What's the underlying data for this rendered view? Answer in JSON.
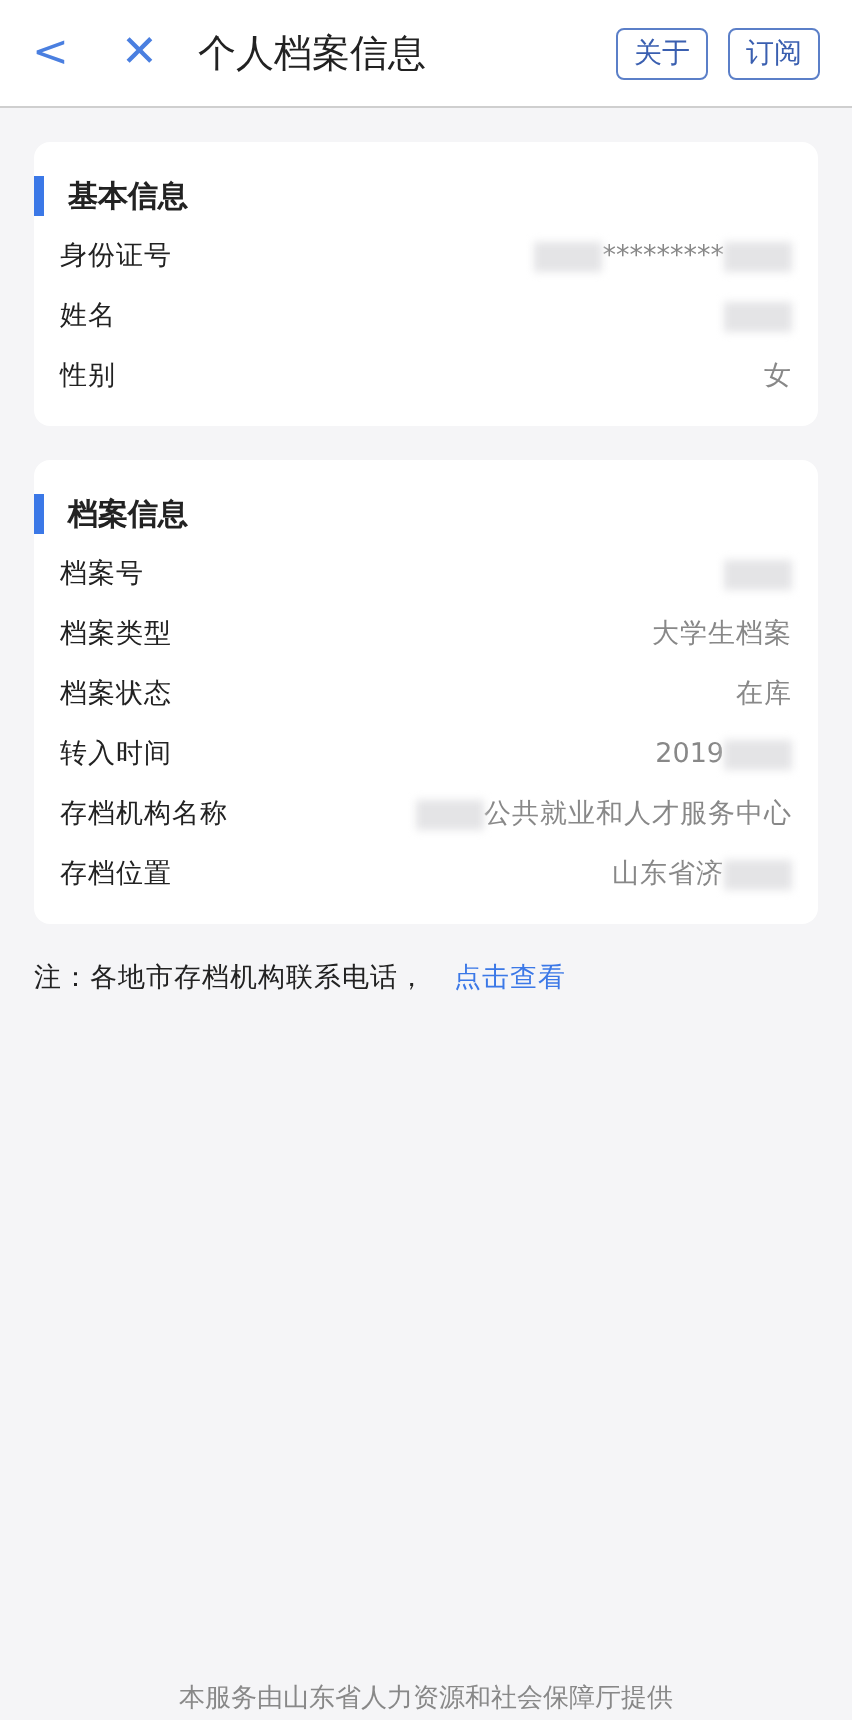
{
  "nav": {
    "back": "<",
    "close": "✕",
    "title": "个人档案信息",
    "buttons": [
      "关于",
      "订阅"
    ]
  },
  "sections": [
    {
      "title": "基本信息",
      "rows": [
        {
          "label": "身份证号",
          "value": [
            {
              "kind": "blur"
            },
            {
              "kind": "text",
              "text": "*********"
            },
            {
              "kind": "blur"
            }
          ]
        },
        {
          "label": "姓名",
          "value": [
            {
              "kind": "blur"
            }
          ]
        },
        {
          "label": "性别",
          "value": [
            {
              "kind": "text",
              "text": "女"
            }
          ]
        }
      ]
    },
    {
      "title": "档案信息",
      "rows": [
        {
          "label": "档案号",
          "value": [
            {
              "kind": "blur"
            }
          ]
        },
        {
          "label": "档案类型",
          "value": [
            {
              "kind": "text",
              "text": "大学生档案"
            }
          ]
        },
        {
          "label": "档案状态",
          "value": [
            {
              "kind": "text",
              "text": "在库"
            }
          ]
        },
        {
          "label": "转入时间",
          "value": [
            {
              "kind": "text",
              "text": "2019"
            },
            {
              "kind": "blur"
            }
          ]
        },
        {
          "label": "存档机构名称",
          "value": [
            {
              "kind": "blur"
            },
            {
              "kind": "text",
              "text": "公共就业和人才服务中心"
            }
          ]
        },
        {
          "label": "存档位置",
          "value": [
            {
              "kind": "text",
              "text": "山东省济"
            },
            {
              "kind": "blur"
            }
          ]
        }
      ]
    }
  ],
  "note": {
    "text": "注：各地市存档机构联系电话，",
    "link": "点击查看"
  },
  "footer": "本服务由山东省人力资源和社会保障厅提供"
}
